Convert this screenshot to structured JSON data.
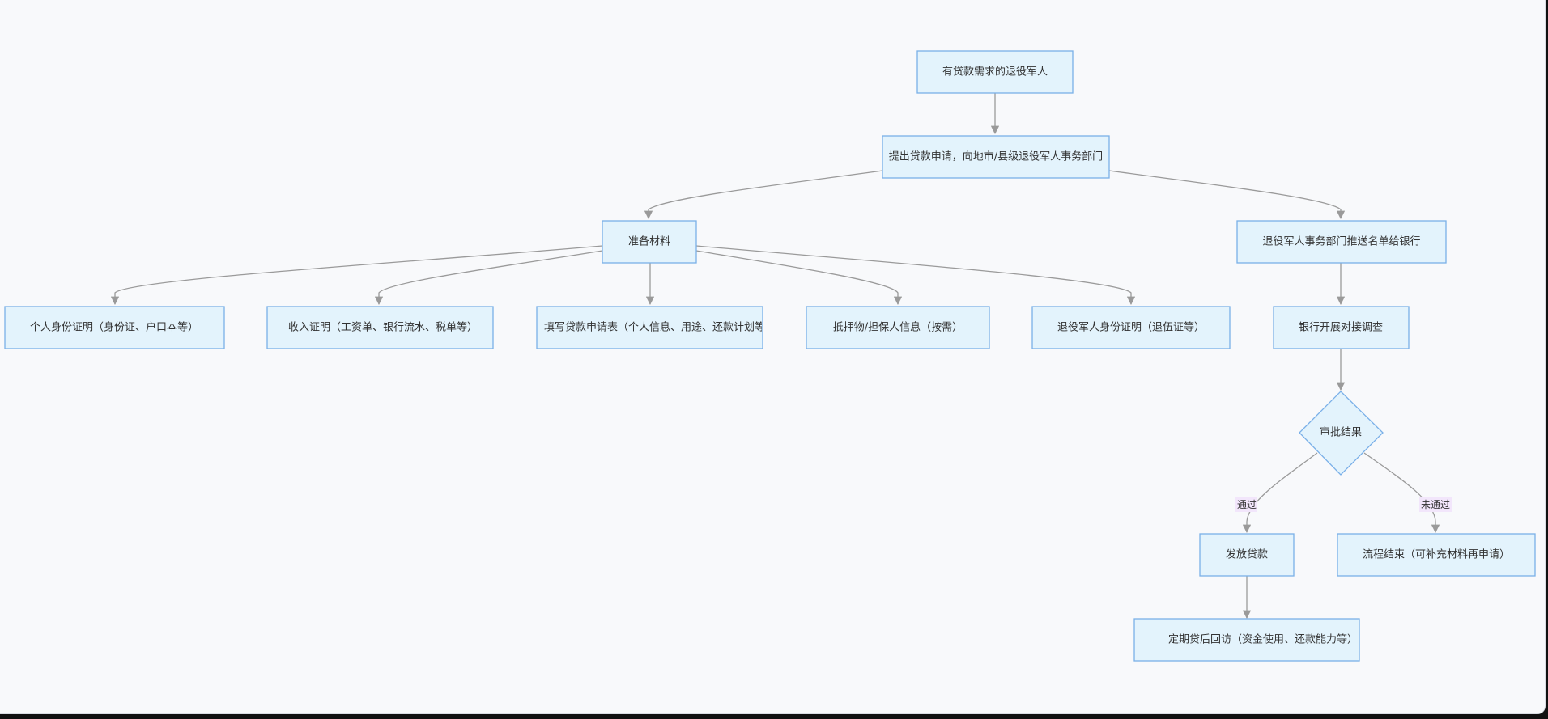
{
  "diagram": {
    "nodes": {
      "veteran": "有贷款需求的退役军人",
      "apply": "提出贷款申请，向地市/县级退役军人事务部门",
      "prepare": "准备材料",
      "push_bank": "退役军人事务部门推送名单给银行",
      "id_card": "个人身份证明（身份证、户口本等）",
      "income": "收入证明（工资单、银行流水、税单等）",
      "form": "填写贷款申请表（个人信息、用途、还款计划等）",
      "collateral": "抵押物/担保人信息（按需）",
      "veteran_id": "退役军人身份证明（退伍证等）",
      "bank_survey": "银行开展对接调查",
      "approval": "审批结果",
      "disburse": "发放贷款",
      "end": "流程结束（可补充材料再申请）",
      "followup": "定期贷后回访（资金使用、还款能力等）"
    },
    "edge_labels": {
      "pass": "通过",
      "fail": "未通过"
    }
  },
  "colors": {
    "node_fill": "#e3f3fc",
    "node_stroke": "#7ab0e8",
    "edge": "#9a9a9a",
    "edge_label_bg": "#f2e6fb",
    "background": "#f8f9fb"
  }
}
